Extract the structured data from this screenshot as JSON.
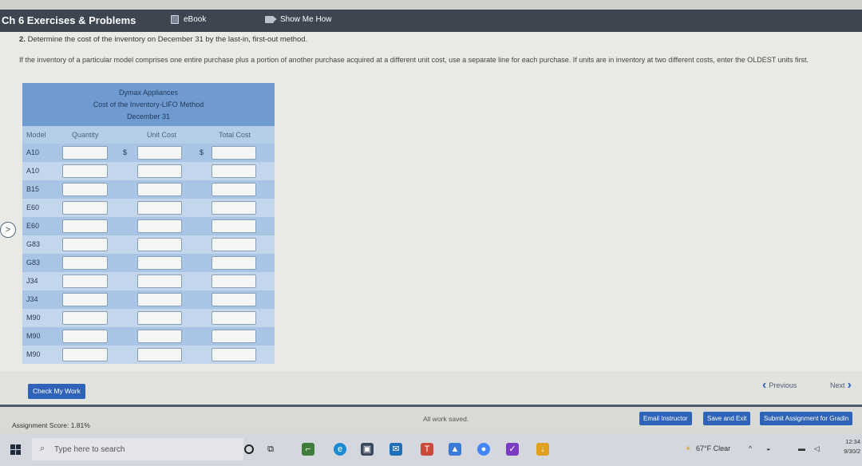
{
  "header": {
    "title": "Ch 6 Exercises & Problems",
    "ebook_label": "eBook",
    "show_me_label": "Show Me How"
  },
  "question": {
    "number": "2.",
    "text": "Determine the cost of the inventory on December 31 by the last-in, first-out method."
  },
  "instruction": "If the inventory of a particular model comprises one entire purchase plus a portion of another purchase acquired at a different unit cost, use a separate line for each purchase. If units are in inventory at two different costs, enter the OLDEST units first.",
  "worksheet": {
    "company": "Dymax Appliances",
    "subtitle": "Cost of the Inventory-LIFO Method",
    "date": "December 31",
    "columns": {
      "model": "Model",
      "quantity": "Quantity",
      "unit_cost": "Unit Cost",
      "total_cost": "Total Cost"
    },
    "dollar_sign": "$",
    "rows": [
      {
        "model": "A10",
        "quantity": "",
        "unit_cost": "",
        "total_cost": ""
      },
      {
        "model": "A10",
        "quantity": "",
        "unit_cost": "",
        "total_cost": ""
      },
      {
        "model": "B15",
        "quantity": "",
        "unit_cost": "",
        "total_cost": ""
      },
      {
        "model": "E60",
        "quantity": "",
        "unit_cost": "",
        "total_cost": ""
      },
      {
        "model": "E60",
        "quantity": "",
        "unit_cost": "",
        "total_cost": ""
      },
      {
        "model": "G83",
        "quantity": "",
        "unit_cost": "",
        "total_cost": ""
      },
      {
        "model": "G83",
        "quantity": "",
        "unit_cost": "",
        "total_cost": ""
      },
      {
        "model": "J34",
        "quantity": "",
        "unit_cost": "",
        "total_cost": ""
      },
      {
        "model": "J34",
        "quantity": "",
        "unit_cost": "",
        "total_cost": ""
      },
      {
        "model": "M90",
        "quantity": "",
        "unit_cost": "",
        "total_cost": ""
      },
      {
        "model": "M90",
        "quantity": "",
        "unit_cost": "",
        "total_cost": ""
      },
      {
        "model": "M90",
        "quantity": "",
        "unit_cost": "",
        "total_cost": ""
      }
    ]
  },
  "actions": {
    "check_label": "Check My Work",
    "previous_label": "Previous",
    "next_label": "Next"
  },
  "footer": {
    "score": "Assignment Score: 1.81%",
    "saved": "All work saved.",
    "email_label": "Email Instructor",
    "save_exit_label": "Save and Exit",
    "submit_label": "Submit Assignment for Gradin"
  },
  "taskbar": {
    "search_placeholder": "Type here to search",
    "weather": "67°F  Clear",
    "time": "12:34",
    "date": "9/30/2"
  },
  "colors": {
    "accent": "#2e63b8",
    "sheet_header": "#6f9bd0",
    "row_a": "#a9c5e6",
    "row_b": "#c3d6ec",
    "topbar": "#3c4550"
  }
}
